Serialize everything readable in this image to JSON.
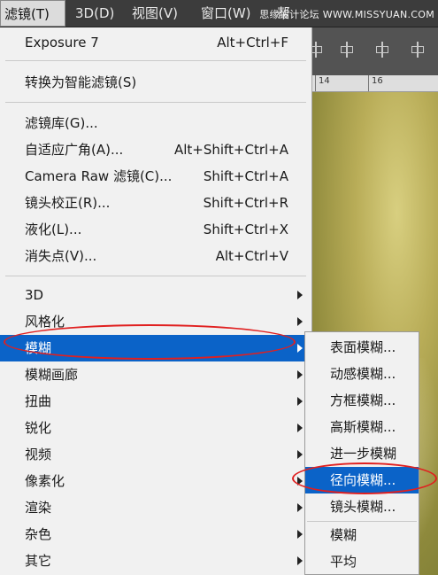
{
  "menubar": {
    "items": [
      "滤镜(T)",
      "3D(D)",
      "视图(V)",
      "窗口(W)",
      "帮"
    ],
    "active_index": 0,
    "watermark": "思缘设计论坛 WWW.MISSYUAN.COM"
  },
  "ruler": {
    "labels": [
      "14",
      "16"
    ]
  },
  "filter_menu": {
    "last_filter": {
      "label": "Exposure 7",
      "shortcut": "Alt+Ctrl+F"
    },
    "convert_smart": {
      "label": "转换为智能滤镜(S)"
    },
    "filters": [
      {
        "label": "滤镜库(G)...",
        "shortcut": ""
      },
      {
        "label": "自适应广角(A)...",
        "shortcut": "Alt+Shift+Ctrl+A"
      },
      {
        "label": "Camera Raw 滤镜(C)...",
        "shortcut": "Shift+Ctrl+A"
      },
      {
        "label": "镜头校正(R)...",
        "shortcut": "Shift+Ctrl+R"
      },
      {
        "label": "液化(L)...",
        "shortcut": "Shift+Ctrl+X"
      },
      {
        "label": "消失点(V)...",
        "shortcut": "Alt+Ctrl+V"
      }
    ],
    "groups": [
      "3D",
      "风格化",
      "模糊",
      "模糊画廊",
      "扭曲",
      "锐化",
      "视频",
      "像素化",
      "渲染",
      "杂色",
      "其它"
    ],
    "highlighted_group": "模糊"
  },
  "blur_submenu": {
    "items": [
      "表面模糊...",
      "动感模糊...",
      "方框模糊...",
      "高斯模糊...",
      "进一步模糊",
      "径向模糊...",
      "镜头模糊...",
      "模糊",
      "平均"
    ],
    "highlighted": "径向模糊...",
    "colors": {
      "highlight": "#0b63c8",
      "annotation": "#e02020"
    }
  }
}
